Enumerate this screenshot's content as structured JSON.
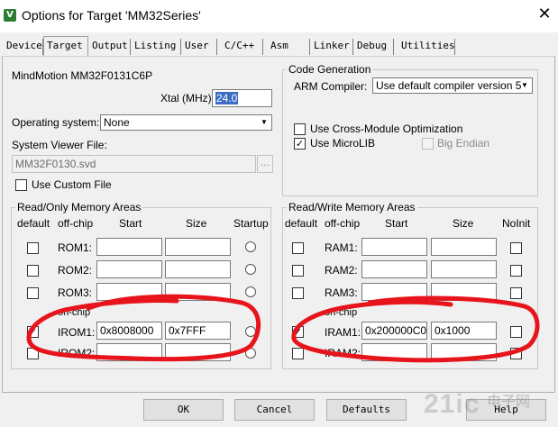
{
  "window": {
    "title": "Options for Target 'MM32Series'",
    "icon": "uvision-icon",
    "close_glyph": "✕"
  },
  "tabs": [
    "Device",
    "Target",
    "Output",
    "Listing",
    "User",
    "C/C++",
    "Asm",
    "Linker",
    "Debug",
    "Utilities"
  ],
  "active_tab": "Target",
  "device": {
    "name": "MindMotion MM32F0131C6P"
  },
  "xtal": {
    "label": "Xtal (MHz):",
    "value": "24.0"
  },
  "os": {
    "label": "Operating system:",
    "value": "None"
  },
  "svd": {
    "label": "System Viewer File:",
    "value": "MM32F0130.svd",
    "browse": "..."
  },
  "custom_file": {
    "label": "Use Custom File",
    "checked": false
  },
  "codegen": {
    "title": "Code Generation",
    "compiler_label": "ARM Compiler:",
    "compiler_value": "Use default compiler version 5",
    "cross_module": {
      "label": "Use Cross-Module Optimization",
      "checked": false
    },
    "microlib": {
      "label": "Use MicroLIB",
      "checked": true
    },
    "big_endian": {
      "label": "Big Endian",
      "checked": false,
      "enabled": false
    }
  },
  "rom": {
    "title": "Read/Only Memory Areas",
    "headers": {
      "default": "default",
      "offchip": "off-chip",
      "start": "Start",
      "size": "Size",
      "startup": "Startup"
    },
    "rows": [
      {
        "name": "ROM1:",
        "start": "",
        "size": "",
        "default": false
      },
      {
        "name": "ROM2:",
        "start": "",
        "size": "",
        "default": false
      },
      {
        "name": "ROM3:",
        "start": "",
        "size": "",
        "default": false
      },
      {
        "name": "IROM1:",
        "start": "0x8008000",
        "size": "0x7FFF",
        "default": true
      },
      {
        "name": "IROM2:",
        "start": "",
        "size": "",
        "default": false
      }
    ],
    "onchip_label": "on-chip"
  },
  "ram": {
    "title": "Read/Write Memory Areas",
    "headers": {
      "default": "default",
      "offchip": "off-chip",
      "start": "Start",
      "size": "Size",
      "noinit": "NoInit"
    },
    "rows": [
      {
        "name": "RAM1:",
        "start": "",
        "size": "",
        "default": false
      },
      {
        "name": "RAM2:",
        "start": "",
        "size": "",
        "default": false
      },
      {
        "name": "RAM3:",
        "start": "",
        "size": "",
        "default": false
      },
      {
        "name": "IRAM1:",
        "start": "0x200000C0",
        "size": "0x1000",
        "default": true
      },
      {
        "name": "IRAM2:",
        "start": "",
        "size": "",
        "default": false
      }
    ],
    "onchip_label": "on-chip"
  },
  "buttons": {
    "ok": "OK",
    "cancel": "Cancel",
    "defaults": "Defaults",
    "help": "Help"
  },
  "watermark": {
    "brand": "21ic",
    "text": "电子网"
  },
  "annotation_color": "#e8141c"
}
